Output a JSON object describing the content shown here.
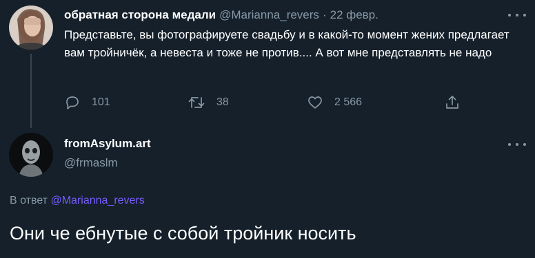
{
  "tweet1": {
    "author_name": "обратная сторона медали",
    "handle": "@Marianna_revers",
    "separator": "·",
    "date": "22 февр.",
    "text": "Представьте, вы фотографируете свадьбу и в какой-то момент жених предлагает вам тройничёк, а невеста и тоже не против.... А вот мне представлять не надо",
    "actions": {
      "reply_count": "101",
      "retweet_count": "38",
      "like_count": "2 566"
    }
  },
  "tweet2": {
    "author_name": "fromAsylum.art",
    "handle": "@frmaslm",
    "reply_prefix": "В ответ",
    "reply_handle": "@Marianna_revers",
    "text": "Они че ебнутые с собой тройник носить"
  },
  "colors": {
    "background": "#15202b",
    "secondary_text": "#8899a6",
    "link": "#7a5cff",
    "thread_line": "#38444d"
  },
  "icons": [
    "reply-icon",
    "retweet-icon",
    "like-icon",
    "share-icon",
    "more-icon"
  ]
}
